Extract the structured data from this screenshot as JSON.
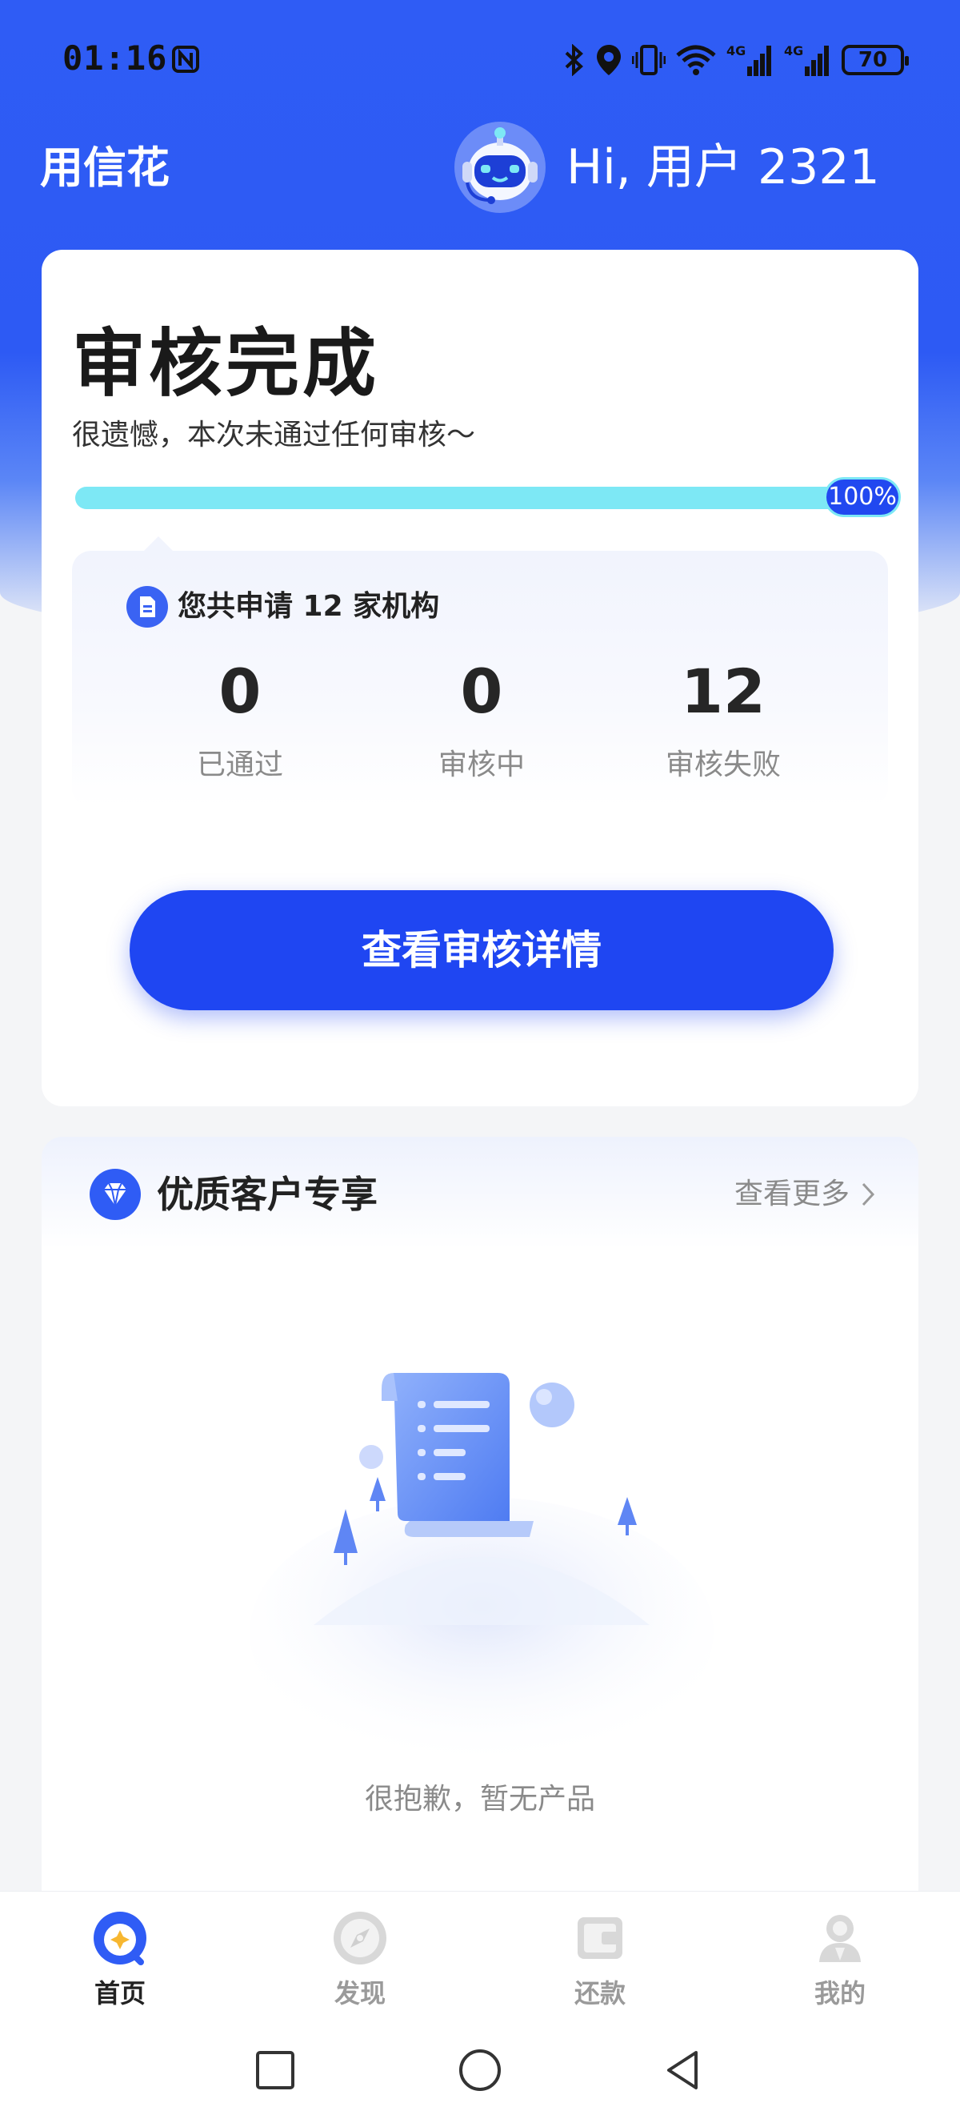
{
  "status_bar": {
    "time": "01:16",
    "battery": "70"
  },
  "header": {
    "app_title": "用信花",
    "greeting": "Hi, 用户 2321"
  },
  "review": {
    "title": "审核完成",
    "subtitle": "很遗憾，本次未通过任何审核～",
    "progress_label": "100%",
    "progress_fraction": 1.0,
    "applied_summary": "您共申请 12 家机构",
    "stats": [
      {
        "value": "0",
        "label": "已通过"
      },
      {
        "value": "0",
        "label": "审核中"
      },
      {
        "value": "12",
        "label": "审核失败"
      }
    ],
    "details_button": "查看审核详情"
  },
  "premium": {
    "title": "优质客户专享",
    "more_label": "查看更多",
    "empty_text": "很抱歉，暂无产品"
  },
  "tabs": [
    {
      "label": "首页",
      "icon": "home-icon",
      "active": true
    },
    {
      "label": "发现",
      "icon": "compass-icon",
      "active": false
    },
    {
      "label": "还款",
      "icon": "wallet-icon",
      "active": false
    },
    {
      "label": "我的",
      "icon": "user-icon",
      "active": false
    }
  ],
  "colors": {
    "brand_blue": "#2f5cf5",
    "button_blue": "#1f46f2",
    "progress_cyan": "#7de8f5"
  }
}
